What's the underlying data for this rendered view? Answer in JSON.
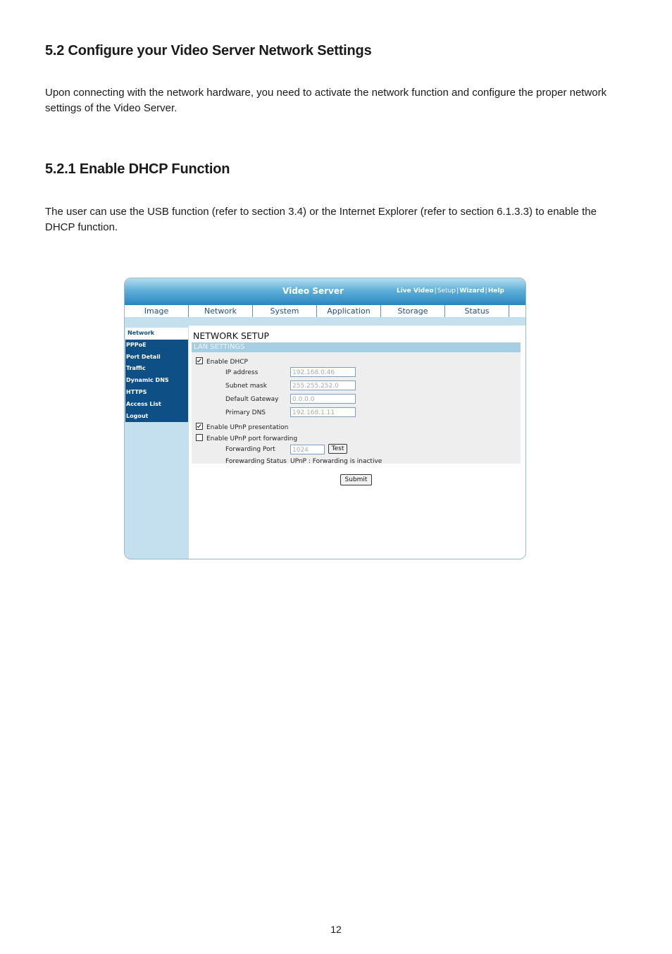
{
  "doc": {
    "heading_52": "5.2  Configure your Video Server Network Settings",
    "para_52": "Upon connecting with the network hardware, you need to activate the network function and configure the proper network settings of the Video Server.",
    "heading_521": "5.2.1  Enable DHCP Function",
    "para_521": "The user can use the USB function (refer to section 3.4) or the Internet Explorer (refer to section 6.1.3.3) to enable the DHCP function.",
    "page_number": "12"
  },
  "screenshot": {
    "brand": "Video Server",
    "top_links": [
      "Live Video",
      "Setup",
      "Wizard",
      "Help"
    ],
    "tabs": [
      "Image",
      "Network",
      "System",
      "Application",
      "Storage",
      "Status"
    ],
    "sidebar": [
      "Network",
      "PPPoE",
      "Port Detail",
      "Traffic",
      "Dynamic DNS",
      "HTTPS",
      "Access List",
      "Logout"
    ],
    "page_title": "NETWORK SETUP",
    "section": "LAN SETTINGS",
    "enable_dhcp": "Enable DHCP",
    "fields": [
      {
        "label": "IP address",
        "value": "192.168.0.46"
      },
      {
        "label": "Subnet mask",
        "value": "255.255.252.0"
      },
      {
        "label": "Default Gateway",
        "value": "0.0.0.0"
      },
      {
        "label": "Primary DNS",
        "value": "192.168.1.11"
      }
    ],
    "enable_upnp": "Enable UPnP presentation",
    "enable_upnp_forwarding": "Enable UPnP port forwarding",
    "forwarding_port_label": "Forwarding Port",
    "forwarding_port_value": "1024",
    "test_button": "Test",
    "forwarding_status_label": "Forewarding Status",
    "forwarding_status_value": "UPnP : Forwarding is inactive",
    "submit_button": "Submit",
    "colors": {
      "header_blue": "#2b86bf",
      "menu_navy": "#0e4f86",
      "panel_light": "#c4dfee"
    }
  }
}
